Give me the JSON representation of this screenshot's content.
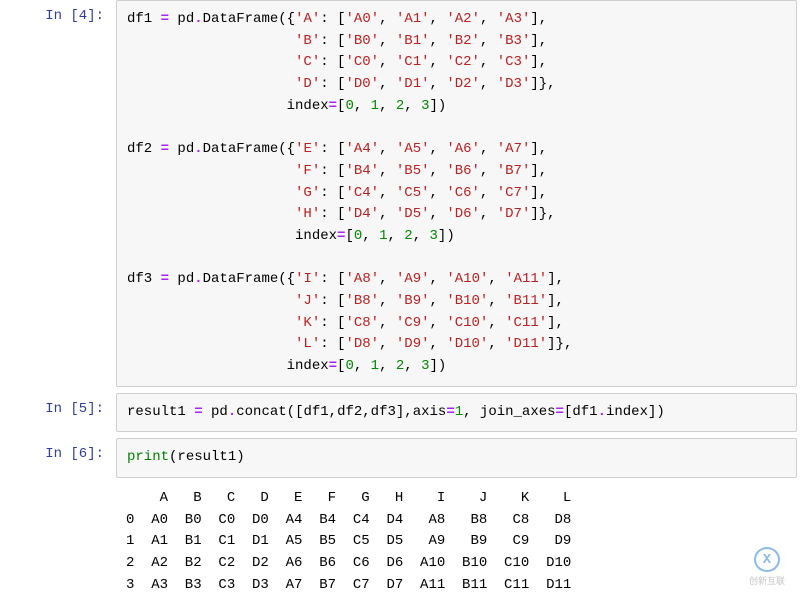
{
  "cells": {
    "c4": {
      "prompt": "In  [4]:",
      "lines": [
        [
          [
            "name",
            "df1 "
          ],
          [
            "op",
            "="
          ],
          [
            "name",
            " pd"
          ],
          [
            "op",
            "."
          ],
          [
            "name",
            "DataFrame"
          ],
          [
            "paren",
            "({"
          ],
          [
            "str",
            "'A'"
          ],
          [
            "paren",
            ": ["
          ],
          [
            "str",
            "'A0'"
          ],
          [
            "paren",
            ", "
          ],
          [
            "str",
            "'A1'"
          ],
          [
            "paren",
            ", "
          ],
          [
            "str",
            "'A2'"
          ],
          [
            "paren",
            ", "
          ],
          [
            "str",
            "'A3'"
          ],
          [
            "paren",
            "],"
          ]
        ],
        [
          [
            "name",
            "                    "
          ],
          [
            "str",
            "'B'"
          ],
          [
            "paren",
            ": ["
          ],
          [
            "str",
            "'B0'"
          ],
          [
            "paren",
            ", "
          ],
          [
            "str",
            "'B1'"
          ],
          [
            "paren",
            ", "
          ],
          [
            "str",
            "'B2'"
          ],
          [
            "paren",
            ", "
          ],
          [
            "str",
            "'B3'"
          ],
          [
            "paren",
            "],"
          ]
        ],
        [
          [
            "name",
            "                    "
          ],
          [
            "str",
            "'C'"
          ],
          [
            "paren",
            ": ["
          ],
          [
            "str",
            "'C0'"
          ],
          [
            "paren",
            ", "
          ],
          [
            "str",
            "'C1'"
          ],
          [
            "paren",
            ", "
          ],
          [
            "str",
            "'C2'"
          ],
          [
            "paren",
            ", "
          ],
          [
            "str",
            "'C3'"
          ],
          [
            "paren",
            "],"
          ]
        ],
        [
          [
            "name",
            "                    "
          ],
          [
            "str",
            "'D'"
          ],
          [
            "paren",
            ": ["
          ],
          [
            "str",
            "'D0'"
          ],
          [
            "paren",
            ", "
          ],
          [
            "str",
            "'D1'"
          ],
          [
            "paren",
            ", "
          ],
          [
            "str",
            "'D2'"
          ],
          [
            "paren",
            ", "
          ],
          [
            "str",
            "'D3'"
          ],
          [
            "paren",
            "]},"
          ]
        ],
        [
          [
            "name",
            "                   index"
          ],
          [
            "op",
            "="
          ],
          [
            "paren",
            "["
          ],
          [
            "num",
            "0"
          ],
          [
            "paren",
            ", "
          ],
          [
            "num",
            "1"
          ],
          [
            "paren",
            ", "
          ],
          [
            "num",
            "2"
          ],
          [
            "paren",
            ", "
          ],
          [
            "num",
            "3"
          ],
          [
            "paren",
            "])"
          ]
        ],
        [
          [
            "name",
            ""
          ],
          [
            "name",
            ""
          ]
        ],
        [
          [
            "name",
            "df2 "
          ],
          [
            "op",
            "="
          ],
          [
            "name",
            " pd"
          ],
          [
            "op",
            "."
          ],
          [
            "name",
            "DataFrame"
          ],
          [
            "paren",
            "({"
          ],
          [
            "str",
            "'E'"
          ],
          [
            "paren",
            ": ["
          ],
          [
            "str",
            "'A4'"
          ],
          [
            "paren",
            ", "
          ],
          [
            "str",
            "'A5'"
          ],
          [
            "paren",
            ", "
          ],
          [
            "str",
            "'A6'"
          ],
          [
            "paren",
            ", "
          ],
          [
            "str",
            "'A7'"
          ],
          [
            "paren",
            "],"
          ]
        ],
        [
          [
            "name",
            "                    "
          ],
          [
            "str",
            "'F'"
          ],
          [
            "paren",
            ": ["
          ],
          [
            "str",
            "'B4'"
          ],
          [
            "paren",
            ", "
          ],
          [
            "str",
            "'B5'"
          ],
          [
            "paren",
            ", "
          ],
          [
            "str",
            "'B6'"
          ],
          [
            "paren",
            ", "
          ],
          [
            "str",
            "'B7'"
          ],
          [
            "paren",
            "],"
          ]
        ],
        [
          [
            "name",
            "                    "
          ],
          [
            "str",
            "'G'"
          ],
          [
            "paren",
            ": ["
          ],
          [
            "str",
            "'C4'"
          ],
          [
            "paren",
            ", "
          ],
          [
            "str",
            "'C5'"
          ],
          [
            "paren",
            ", "
          ],
          [
            "str",
            "'C6'"
          ],
          [
            "paren",
            ", "
          ],
          [
            "str",
            "'C7'"
          ],
          [
            "paren",
            "],"
          ]
        ],
        [
          [
            "name",
            "                    "
          ],
          [
            "str",
            "'H'"
          ],
          [
            "paren",
            ": ["
          ],
          [
            "str",
            "'D4'"
          ],
          [
            "paren",
            ", "
          ],
          [
            "str",
            "'D5'"
          ],
          [
            "paren",
            ", "
          ],
          [
            "str",
            "'D6'"
          ],
          [
            "paren",
            ", "
          ],
          [
            "str",
            "'D7'"
          ],
          [
            "paren",
            "]},"
          ]
        ],
        [
          [
            "name",
            "                    index"
          ],
          [
            "op",
            "="
          ],
          [
            "paren",
            "["
          ],
          [
            "num",
            "0"
          ],
          [
            "paren",
            ", "
          ],
          [
            "num",
            "1"
          ],
          [
            "paren",
            ", "
          ],
          [
            "num",
            "2"
          ],
          [
            "paren",
            ", "
          ],
          [
            "num",
            "3"
          ],
          [
            "paren",
            "])"
          ]
        ],
        [
          [
            "name",
            ""
          ],
          [
            "name",
            ""
          ]
        ],
        [
          [
            "name",
            "df3 "
          ],
          [
            "op",
            "="
          ],
          [
            "name",
            " pd"
          ],
          [
            "op",
            "."
          ],
          [
            "name",
            "DataFrame"
          ],
          [
            "paren",
            "({"
          ],
          [
            "str",
            "'I'"
          ],
          [
            "paren",
            ": ["
          ],
          [
            "str",
            "'A8'"
          ],
          [
            "paren",
            ", "
          ],
          [
            "str",
            "'A9'"
          ],
          [
            "paren",
            ", "
          ],
          [
            "str",
            "'A10'"
          ],
          [
            "paren",
            ", "
          ],
          [
            "str",
            "'A11'"
          ],
          [
            "paren",
            "],"
          ]
        ],
        [
          [
            "name",
            "                    "
          ],
          [
            "str",
            "'J'"
          ],
          [
            "paren",
            ": ["
          ],
          [
            "str",
            "'B8'"
          ],
          [
            "paren",
            ", "
          ],
          [
            "str",
            "'B9'"
          ],
          [
            "paren",
            ", "
          ],
          [
            "str",
            "'B10'"
          ],
          [
            "paren",
            ", "
          ],
          [
            "str",
            "'B11'"
          ],
          [
            "paren",
            "],"
          ]
        ],
        [
          [
            "name",
            "                    "
          ],
          [
            "str",
            "'K'"
          ],
          [
            "paren",
            ": ["
          ],
          [
            "str",
            "'C8'"
          ],
          [
            "paren",
            ", "
          ],
          [
            "str",
            "'C9'"
          ],
          [
            "paren",
            ", "
          ],
          [
            "str",
            "'C10'"
          ],
          [
            "paren",
            ", "
          ],
          [
            "str",
            "'C11'"
          ],
          [
            "paren",
            "],"
          ]
        ],
        [
          [
            "name",
            "                    "
          ],
          [
            "str",
            "'L'"
          ],
          [
            "paren",
            ": ["
          ],
          [
            "str",
            "'D8'"
          ],
          [
            "paren",
            ", "
          ],
          [
            "str",
            "'D9'"
          ],
          [
            "paren",
            ", "
          ],
          [
            "str",
            "'D10'"
          ],
          [
            "paren",
            ", "
          ],
          [
            "str",
            "'D11'"
          ],
          [
            "paren",
            "]},"
          ]
        ],
        [
          [
            "name",
            "                   index"
          ],
          [
            "op",
            "="
          ],
          [
            "paren",
            "["
          ],
          [
            "num",
            "0"
          ],
          [
            "paren",
            ", "
          ],
          [
            "num",
            "1"
          ],
          [
            "paren",
            ", "
          ],
          [
            "num",
            "2"
          ],
          [
            "paren",
            ", "
          ],
          [
            "num",
            "3"
          ],
          [
            "paren",
            "])"
          ]
        ]
      ]
    },
    "c5": {
      "prompt": "In  [5]:",
      "lines": [
        [
          [
            "name",
            "result1 "
          ],
          [
            "op",
            "="
          ],
          [
            "name",
            " pd"
          ],
          [
            "op",
            "."
          ],
          [
            "name",
            "concat"
          ],
          [
            "paren",
            "([df1,df2,df3],axis"
          ],
          [
            "op",
            "="
          ],
          [
            "num",
            "1"
          ],
          [
            "paren",
            ", join_axes"
          ],
          [
            "op",
            "="
          ],
          [
            "paren",
            "[df1"
          ],
          [
            "op",
            "."
          ],
          [
            "paren",
            "index])"
          ]
        ]
      ]
    },
    "c6": {
      "prompt": "In  [6]:",
      "lines": [
        [
          [
            "builtin",
            "print"
          ],
          [
            "paren",
            "("
          ],
          [
            "name",
            "result1"
          ],
          [
            "paren",
            ")"
          ]
        ]
      ],
      "output": "    A   B   C   D   E   F   G   H    I    J    K    L\n0  A0  B0  C0  D0  A4  B4  C4  D4   A8   B8   C8   D8\n1  A1  B1  C1  D1  A5  B5  C5  D5   A9   B9   C9   D9\n2  A2  B2  C2  D2  A6  B6  C6  D6  A10  B10  C10  D10\n3  A3  B3  C3  D3  A7  B7  C7  D7  A11  B11  C11  D11"
    }
  },
  "watermark": {
    "letter": "X",
    "text": "创新互联"
  }
}
